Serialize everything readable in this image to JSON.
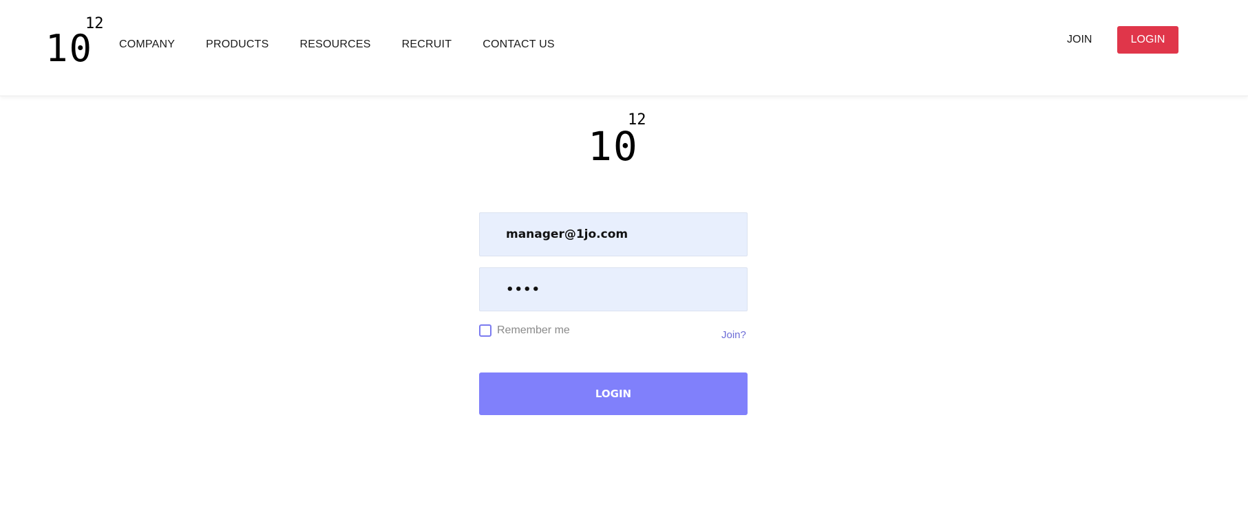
{
  "brand": {
    "logo_base": "10",
    "logo_exponent": "12"
  },
  "header": {
    "nav": [
      "COMPANY",
      "PRODUCTS",
      "RESOURCES",
      "RECRUIT",
      "CONTACT US"
    ],
    "join_label": "JOIN",
    "login_label": "LOGIN"
  },
  "login_form": {
    "email_value": "manager@1jo.com",
    "password_value": "1234",
    "remember_label": "Remember me",
    "remember_checked": false,
    "join_link": "Join?",
    "submit_label": "LOGIN"
  },
  "colors": {
    "header_login_button": "#e0364a",
    "submit_button": "#8080fb",
    "input_background": "#e8effd",
    "link_accent": "#6b6bd6"
  }
}
